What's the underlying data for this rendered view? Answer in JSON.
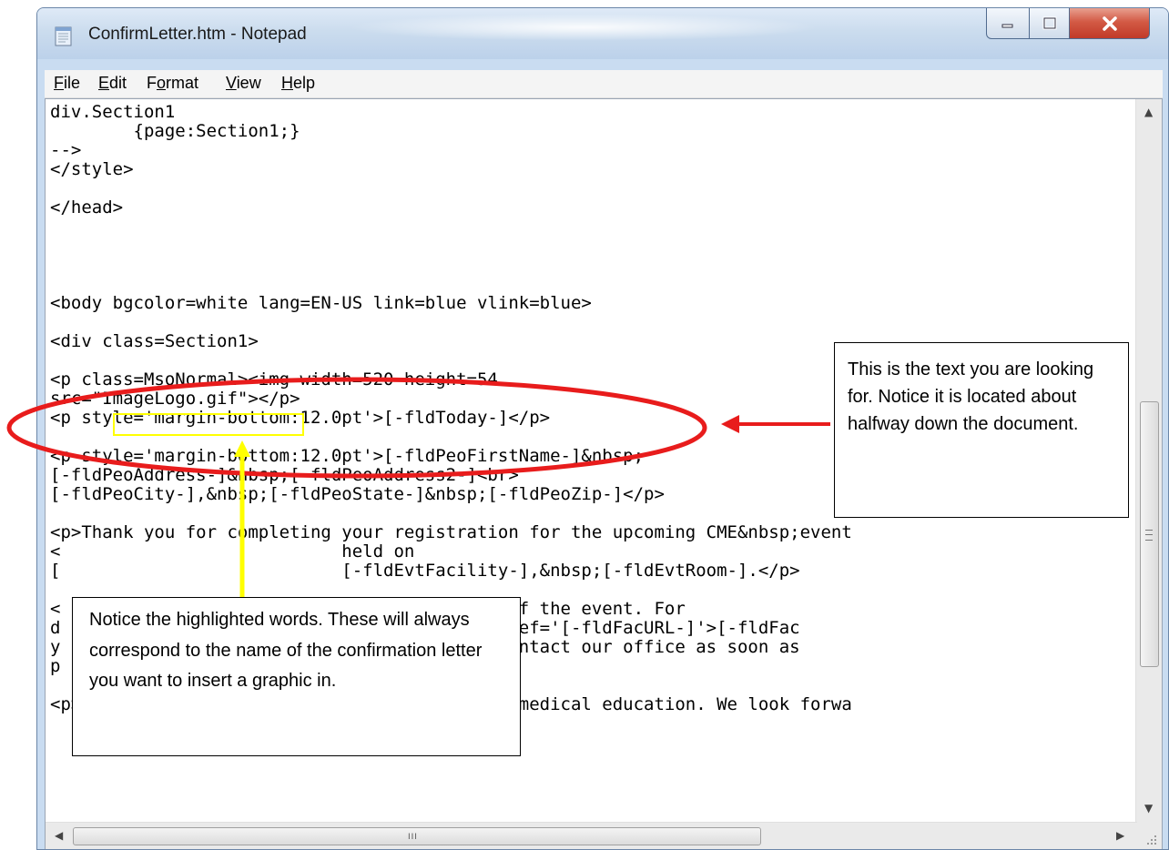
{
  "window": {
    "title": "ConfirmLetter.htm - Notepad",
    "icon": "notepad-icon"
  },
  "menu": [
    {
      "label": "File",
      "accel": "F",
      "rest": "ile"
    },
    {
      "label": "Edit",
      "accel": "E",
      "rest": "dit"
    },
    {
      "label": "Format",
      "pre": "F",
      "accel": "o",
      "rest": "rmat"
    },
    {
      "label": "View",
      "accel": "V",
      "rest": "iew"
    },
    {
      "label": "Help",
      "accel": "H",
      "rest": "elp"
    }
  ],
  "editor": {
    "lines": [
      "div.Section1",
      "        {page:Section1;}",
      "-->",
      "</style>",
      "",
      "</head>",
      "",
      "",
      "",
      "",
      "<body bgcolor=white lang=EN-US link=blue vlink=blue>",
      "",
      "<div class=Section1>",
      "",
      "<p class=MsoNormal><img width=520 height=54",
      "src=\"ImageLogo.gif\"></p>",
      "<p style='margin-bottom:12.0pt'>[-fldToday-]</p>",
      "",
      "<p style='margin-bottom:12.0pt'>[-fldPeoFirstName-]&nbsp;",
      "[-fldPeoAddress-]&nbsp;[-fldPeoAddress2-]<br>",
      "[-fldPeoCity-],&nbsp;[-fldPeoState-]&nbsp;[-fldPeoZip-]</p>",
      "",
      "<p>Thank you for completing your registration for the upcoming CME&nbsp;event",
      "<                           held on",
      "[                           [-fldEvtFacility-],&nbsp;[-fldEvtRoom-].</p>",
      "",
      "<                           me-] on the day of the event. For",
      "d                           ty-], visit <a href='[-fldFacURL-]'>[-fldFac",
      "y                           erence, please contact our office as soon as",
      "p",
      "",
      "<p>Thank you for participating in continuing medical education. We look forwa"
    ]
  },
  "annotations": {
    "right_callout": "This is the text you are looking for.  Notice it is located about halfway down the document.",
    "bottom_callout": "Notice the highlighted words.  These will always correspond to the name of the confirmation letter you want to insert a graphic in."
  },
  "colors": {
    "annotation_red": "#e81c1c",
    "highlight_yellow": "#ffff00",
    "arrow_yellow": "#ffff00"
  }
}
